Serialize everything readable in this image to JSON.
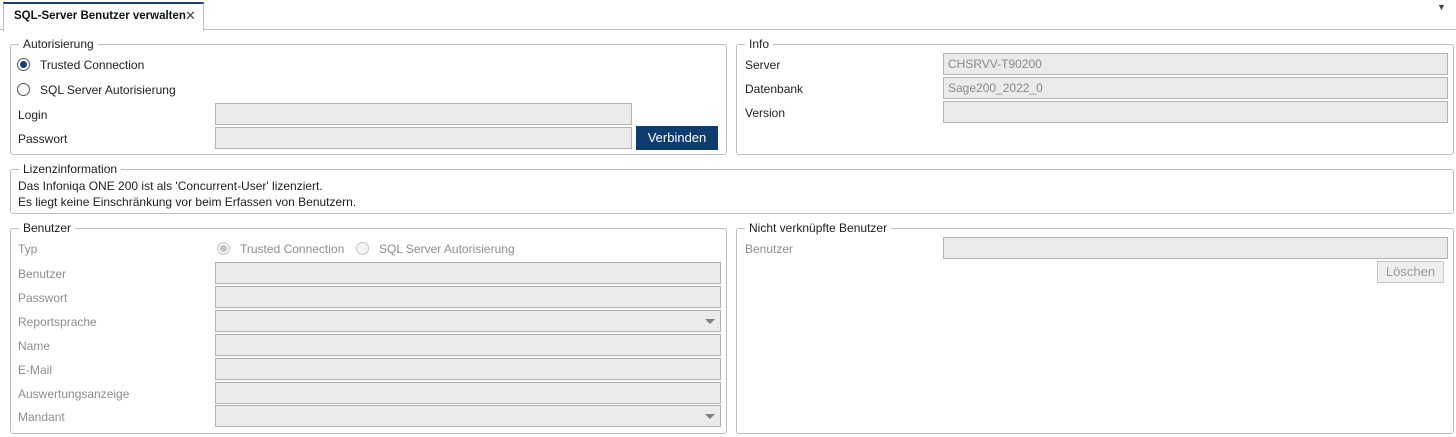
{
  "tab": {
    "title": "SQL-Server Benutzer verwalten"
  },
  "autorisierung": {
    "legend": "Autorisierung",
    "radio_trusted": "Trusted Connection",
    "radio_sql": "SQL Server Autorisierung",
    "login_label": "Login",
    "login_value": "",
    "passwort_label": "Passwort",
    "passwort_value": "",
    "connect_button": "Verbinden",
    "selected": "trusted"
  },
  "info": {
    "legend": "Info",
    "server_label": "Server",
    "server_value": "CHSRVV-T90200",
    "datenbank_label": "Datenbank",
    "datenbank_value": "Sage200_2022_0",
    "version_label": "Version",
    "version_value": ""
  },
  "lizenz": {
    "legend": "Lizenzinformation",
    "line1": "Das Infoniqa ONE 200 ist als 'Concurrent-User' lizenziert.",
    "line2": "Es liegt keine Einschränkung vor beim Erfassen von Benutzern."
  },
  "benutzer": {
    "legend": "Benutzer",
    "typ_label": "Typ",
    "radio_trusted": "Trusted Connection",
    "radio_sql": "SQL Server Autorisierung",
    "benutzer_label": "Benutzer",
    "passwort_label": "Passwort",
    "reportsprache_label": "Reportsprache",
    "name_label": "Name",
    "email_label": "E-Mail",
    "auswertung_label": "Auswertungsanzeige",
    "mandant_label": "Mandant"
  },
  "nicht_verknuepft": {
    "legend": "Nicht verknüpfte Benutzer",
    "benutzer_label": "Benutzer",
    "delete_button": "Löschen"
  },
  "colors": {
    "accent": "#0e3c6f",
    "disabled_field": "#ebebeb",
    "border": "#bdbdbd"
  }
}
